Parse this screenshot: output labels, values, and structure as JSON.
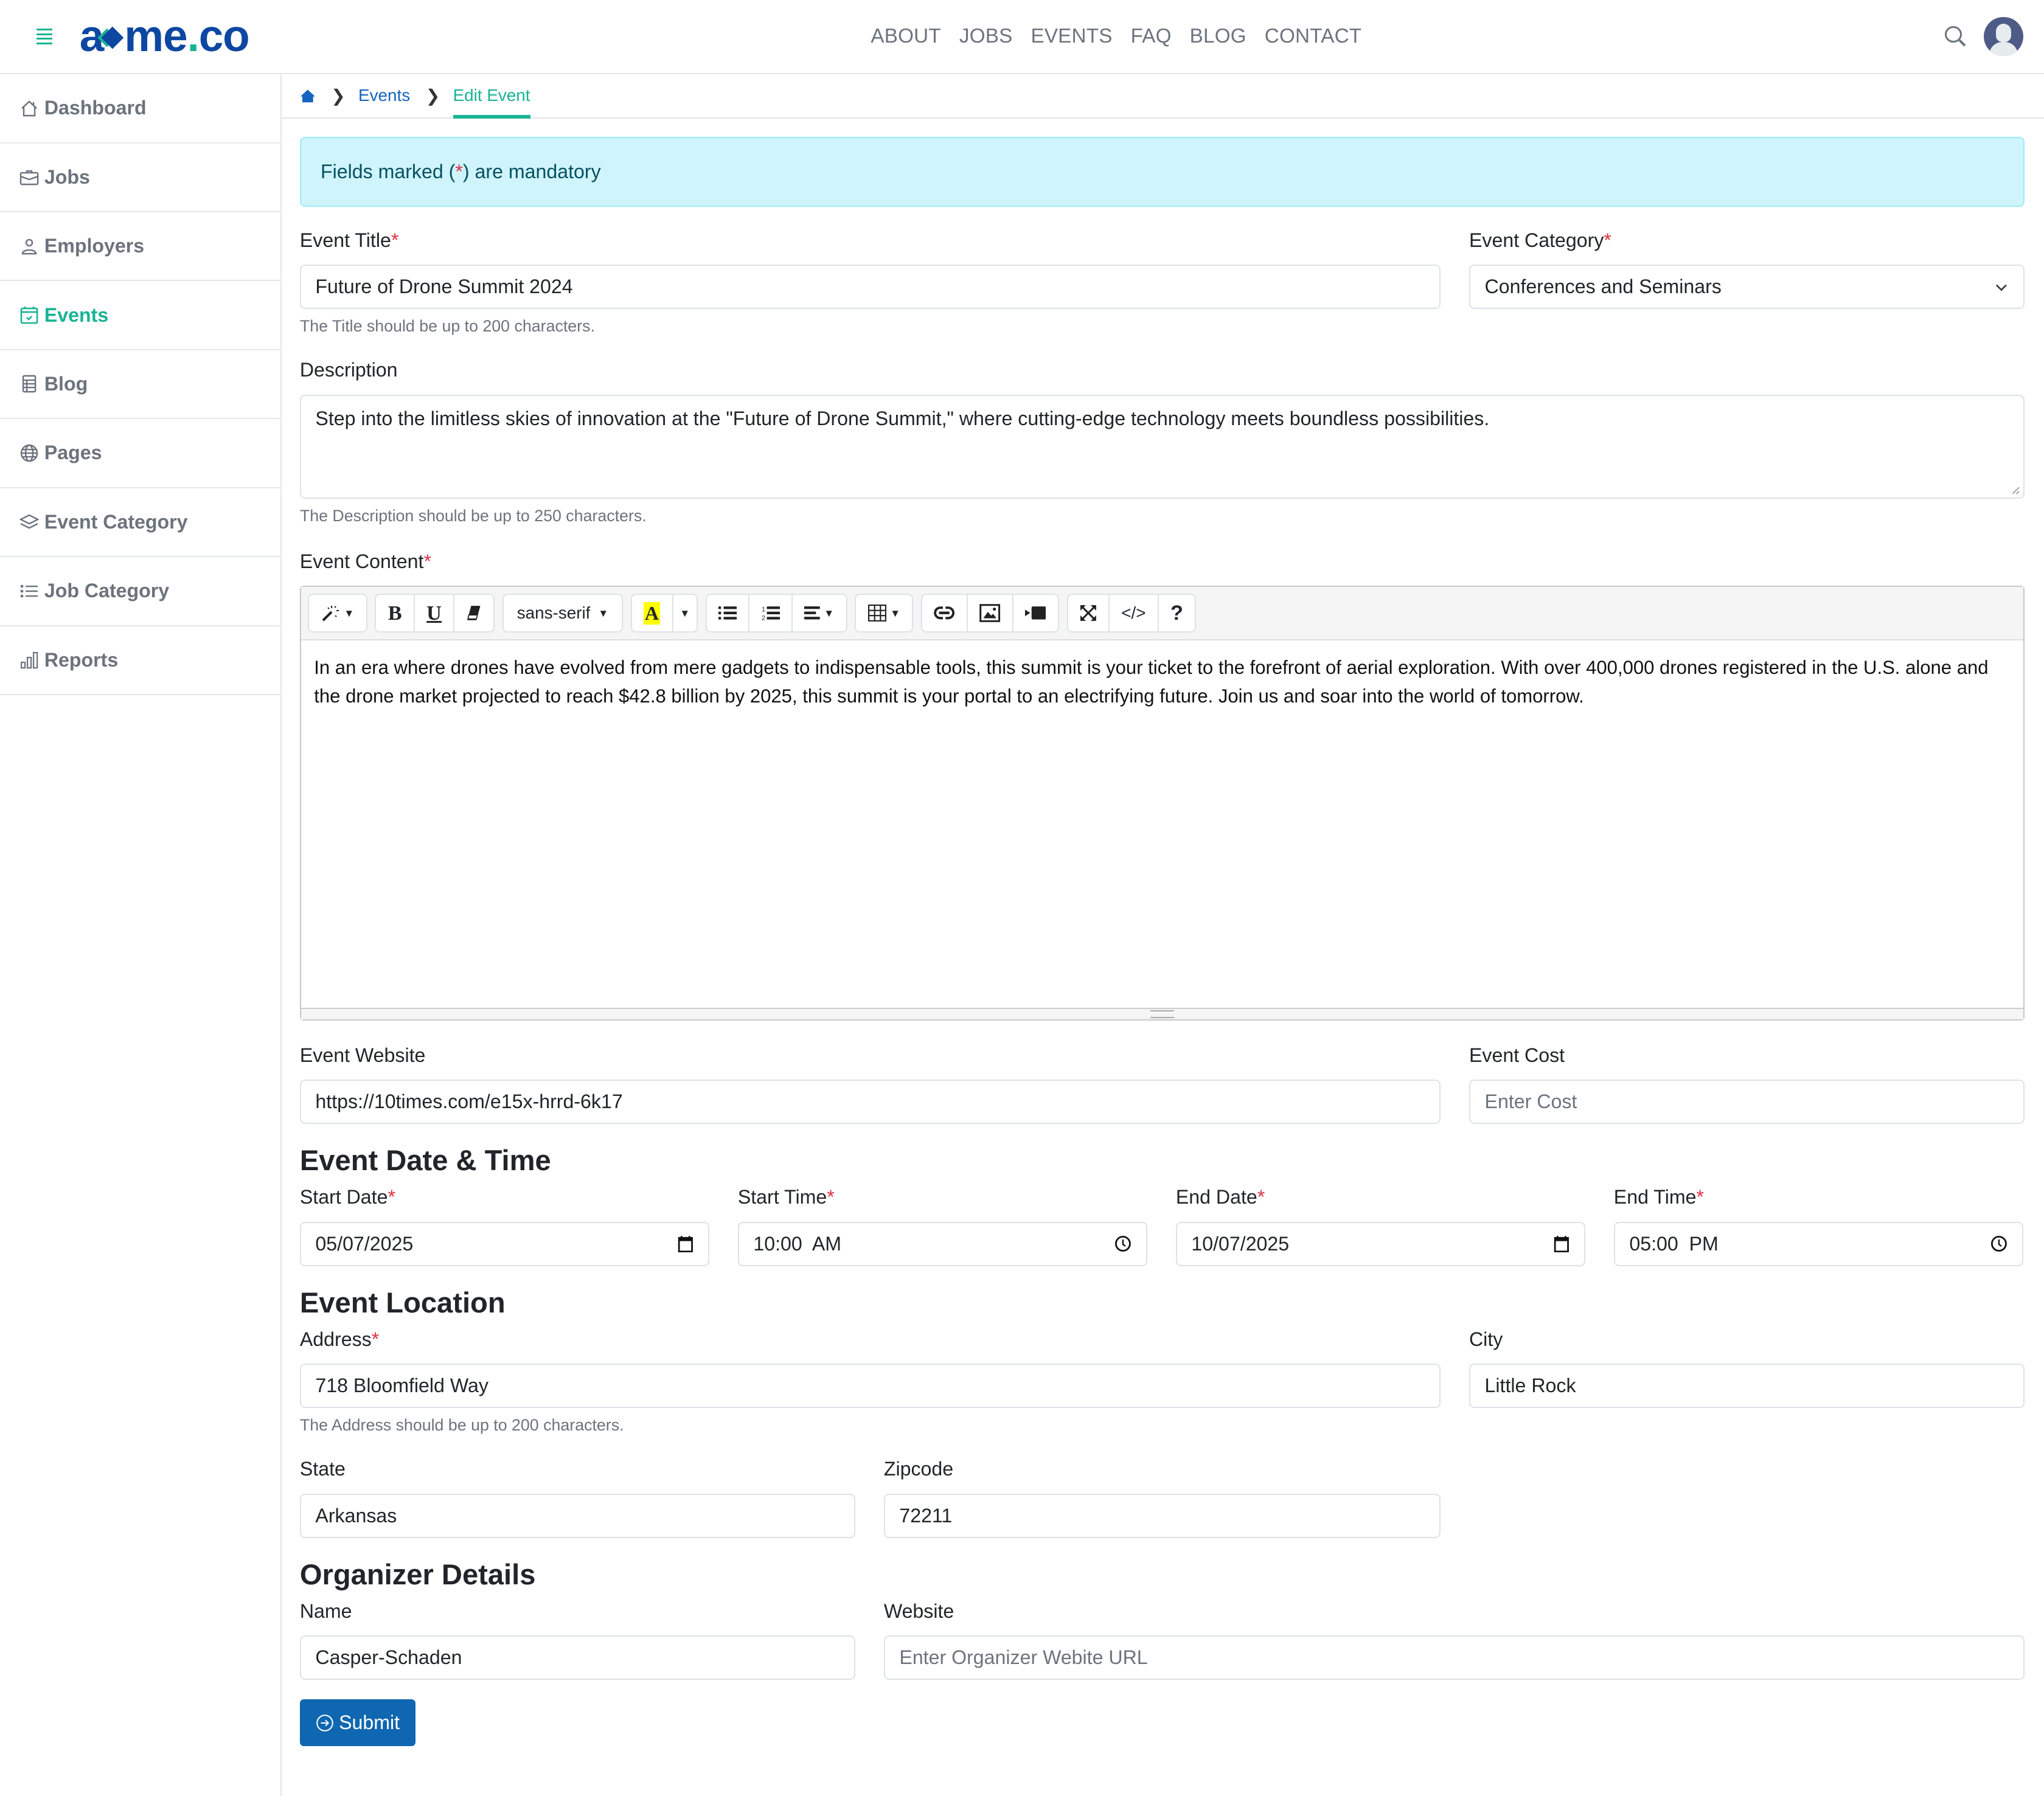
{
  "header": {
    "logo": {
      "part1": "a",
      "part2": "me",
      "dot": ".",
      "part3": "co"
    },
    "nav": [
      "ABOUT",
      "JOBS",
      "EVENTS",
      "FAQ",
      "BLOG",
      "CONTACT"
    ]
  },
  "sidebar": {
    "items": [
      {
        "label": "Dashboard",
        "icon": "house-icon"
      },
      {
        "label": "Jobs",
        "icon": "briefcase-icon"
      },
      {
        "label": "Employers",
        "icon": "person-icon"
      },
      {
        "label": "Events",
        "icon": "calendar-check-icon",
        "active": true
      },
      {
        "label": "Blog",
        "icon": "document-icon"
      },
      {
        "label": "Pages",
        "icon": "globe-icon"
      },
      {
        "label": "Event Category",
        "icon": "layers-icon"
      },
      {
        "label": "Job Category",
        "icon": "list-icon"
      },
      {
        "label": "Reports",
        "icon": "bar-chart-icon"
      }
    ]
  },
  "breadcrumb": {
    "items": [
      "Events"
    ],
    "current": "Edit Event"
  },
  "alert": {
    "before": "Fields marked (",
    "star": "*",
    "after": ") are mandatory"
  },
  "form": {
    "title": {
      "label": "Event Title",
      "value": "Future of Drone Summit 2024",
      "hint": "The Title should be up to 200 characters."
    },
    "category": {
      "label": "Event Category",
      "value": "Conferences and Seminars"
    },
    "description": {
      "label": "Description",
      "value": "Step into the limitless skies of innovation at the \"Future of Drone Summit,\" where cutting-edge technology meets boundless possibilities.",
      "hint": "The Description should be up to 250 characters."
    },
    "content": {
      "label": "Event Content",
      "font": "sans-serif",
      "text": "In an era where drones have evolved from mere gadgets to indispensable tools, this summit is your ticket to the forefront of aerial exploration. With over 400,000 drones registered in the U.S. alone and the drone market projected to reach $42.8 billion by 2025, this summit is your portal to an electrifying future. Join us and soar into the world of tomorrow."
    },
    "website": {
      "label": "Event Website",
      "value": "https://10times.com/e15x-hrrd-6k17"
    },
    "cost": {
      "label": "Event Cost",
      "placeholder": "Enter Cost"
    },
    "datetime_title": "Event Date & Time",
    "start_date": {
      "label": "Start Date",
      "value": "05/07/2025"
    },
    "start_time": {
      "label": "Start Time",
      "value": "10:00  AM"
    },
    "end_date": {
      "label": "End Date",
      "value": "10/07/2025"
    },
    "end_time": {
      "label": "End Time",
      "value": "05:00  PM"
    },
    "location_title": "Event Location",
    "address": {
      "label": "Address",
      "value": "718 Bloomfield Way",
      "hint": "The Address should be up to 200 characters."
    },
    "city": {
      "label": "City",
      "value": "Little Rock"
    },
    "state": {
      "label": "State",
      "value": "Arkansas"
    },
    "zipcode": {
      "label": "Zipcode",
      "value": "72211"
    },
    "organizer_title": "Organizer Details",
    "org_name": {
      "label": "Name",
      "value": "Casper-Schaden"
    },
    "org_website": {
      "label": "Website",
      "placeholder": "Enter Organizer Webite URL"
    },
    "submit": "Submit",
    "required_mark": "*"
  },
  "colors": {
    "accent": "#19b394",
    "brand": "#0d47a1",
    "link": "#1565c0",
    "primary_button": "#0f67b1",
    "required": "#dc3545",
    "alert_bg": "#cff4fc"
  }
}
